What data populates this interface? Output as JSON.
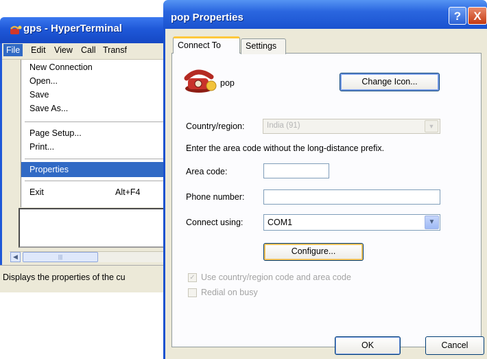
{
  "hyperterminal": {
    "title": "gps - HyperTerminal",
    "menu": [
      "File",
      "Edit",
      "View",
      "Call",
      "Transf"
    ],
    "file_menu": {
      "new_connection": "New Connection",
      "open": "Open...",
      "save": "Save",
      "save_as": "Save As...",
      "page_setup": "Page Setup...",
      "print": "Print...",
      "properties": "Properties",
      "exit": "Exit",
      "exit_shortcut": "Alt+F4"
    },
    "status_text": "Displays the properties of the cu"
  },
  "dialog": {
    "title": "pop Properties",
    "help_glyph": "?",
    "close_glyph": "X",
    "tabs": [
      "Connect To",
      "Settings"
    ],
    "connection_name": "pop",
    "change_icon_label": "Change Icon...",
    "country_label": "Country/region:",
    "country_value": "India (91)",
    "area_hint": "Enter the area code without the long-distance prefix.",
    "area_code_label": "Area code:",
    "area_code_value": "",
    "phone_label": "Phone number:",
    "phone_value": "",
    "connect_using_label": "Connect using:",
    "connect_using_value": "COM1",
    "configure_label": "Configure...",
    "use_country_label": "Use country/region code and area code",
    "use_country_checked": true,
    "redial_label": "Redial on busy",
    "redial_checked": false,
    "ok_label": "OK",
    "cancel_label": "Cancel"
  },
  "icons": [
    "hyperterminal-app-icon",
    "phone-connection-icon",
    "help-icon",
    "close-icon",
    "chevron-down-icon",
    "scroll-left-icon",
    "checkmark-icon"
  ],
  "colors": {
    "xp_title_blue": "#2a66df",
    "menu_highlight": "#316ac5",
    "dialog_face": "#ece9d8",
    "close_red": "#c43a12",
    "default_button_focus": "#f4c45b"
  }
}
